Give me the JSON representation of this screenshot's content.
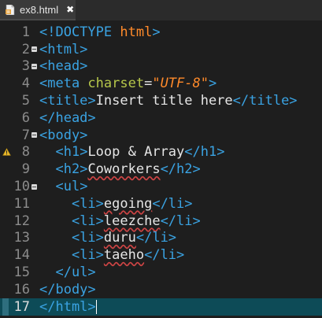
{
  "tab": {
    "label": "ex8.html",
    "close": "✖"
  },
  "lines": [
    {
      "n": "1",
      "parts": [
        [
          "tag",
          "<!DOCTYPE "
        ],
        [
          "str_plain",
          "html"
        ],
        [
          "tag",
          ">"
        ]
      ]
    },
    {
      "n": "2",
      "fold": true,
      "parts": [
        [
          "tag",
          "<html>"
        ]
      ]
    },
    {
      "n": "3",
      "fold": true,
      "parts": [
        [
          "tag",
          "<head>"
        ]
      ]
    },
    {
      "n": "4",
      "parts": [
        [
          "tag",
          "<meta "
        ],
        [
          "attr",
          "charset"
        ],
        [
          "text",
          "="
        ],
        [
          "str",
          "\"UTF-8\""
        ],
        [
          "tag",
          ">"
        ]
      ]
    },
    {
      "n": "5",
      "parts": [
        [
          "tag",
          "<title>"
        ],
        [
          "text",
          "Insert title here"
        ],
        [
          "tag",
          "</title>"
        ]
      ]
    },
    {
      "n": "6",
      "parts": [
        [
          "tag",
          "</head>"
        ]
      ]
    },
    {
      "n": "7",
      "fold": true,
      "parts": [
        [
          "tag",
          "<body>"
        ]
      ]
    },
    {
      "n": "8",
      "warn": true,
      "parts": [
        [
          "text",
          "  "
        ],
        [
          "tag",
          "<h1>"
        ],
        [
          "text",
          "Loop & Array"
        ],
        [
          "tag",
          "</h1>"
        ]
      ]
    },
    {
      "n": "9",
      "parts": [
        [
          "text",
          "  "
        ],
        [
          "tag",
          "<h2>"
        ],
        [
          "spell",
          "Coworkers"
        ],
        [
          "tag",
          "</h2>"
        ]
      ]
    },
    {
      "n": "10",
      "fold": true,
      "parts": [
        [
          "text",
          "  "
        ],
        [
          "tag",
          "<ul>"
        ]
      ]
    },
    {
      "n": "11",
      "parts": [
        [
          "text",
          "    "
        ],
        [
          "tag",
          "<li>"
        ],
        [
          "spell",
          "egoing"
        ],
        [
          "tag",
          "</li>"
        ]
      ]
    },
    {
      "n": "12",
      "parts": [
        [
          "text",
          "    "
        ],
        [
          "tag",
          "<li>"
        ],
        [
          "spell",
          "leezche"
        ],
        [
          "tag",
          "</li>"
        ]
      ]
    },
    {
      "n": "13",
      "parts": [
        [
          "text",
          "    "
        ],
        [
          "tag",
          "<li>"
        ],
        [
          "spell",
          "duru"
        ],
        [
          "tag",
          "</li>"
        ]
      ]
    },
    {
      "n": "14",
      "parts": [
        [
          "text",
          "    "
        ],
        [
          "tag",
          "<li>"
        ],
        [
          "spell",
          "taeho"
        ],
        [
          "tag",
          "</li>"
        ]
      ]
    },
    {
      "n": "15",
      "parts": [
        [
          "text",
          "  "
        ],
        [
          "tag",
          "</ul>"
        ]
      ]
    },
    {
      "n": "16",
      "parts": [
        [
          "tag",
          "</body>"
        ]
      ]
    },
    {
      "n": "17",
      "current": true,
      "parts": [
        [
          "tag",
          "</html>"
        ]
      ]
    }
  ],
  "colors": {
    "tag": "#3aa3e3",
    "attr": "#b6c74a",
    "string": "#ff8a2a",
    "text": "#e6e6e6",
    "background": "#1e1e1e",
    "current_line": "#0d4b57"
  },
  "icons": {
    "file": "html-file-icon",
    "warning": "warning-icon",
    "fold": "fold-collapse-icon",
    "close": "close-icon"
  }
}
